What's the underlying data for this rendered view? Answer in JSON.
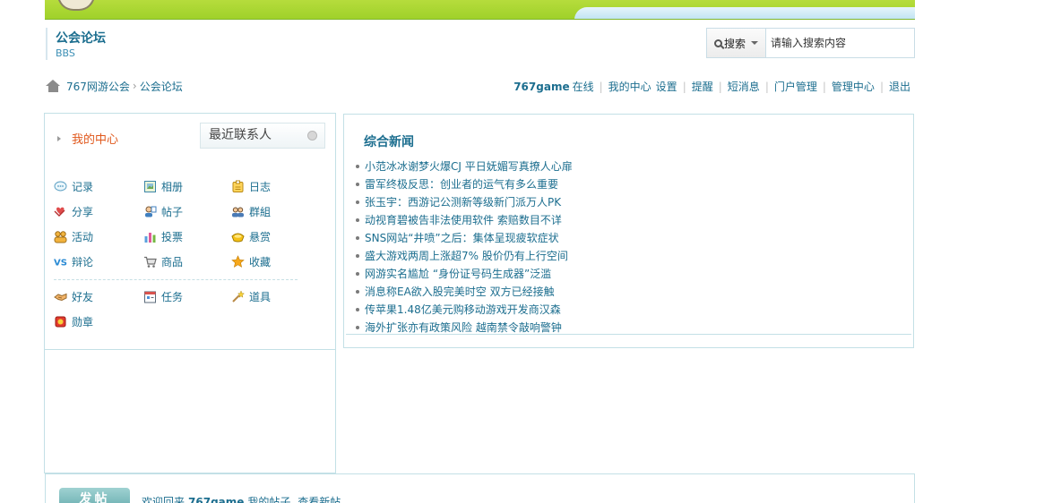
{
  "header": {
    "title": "公会论坛",
    "subtitle": "BBS"
  },
  "search": {
    "button_label": "搜索",
    "placeholder": "请输入搜索内容"
  },
  "breadcrumb": {
    "items": [
      "767网游公会",
      "公会论坛"
    ],
    "separator": "›"
  },
  "topnav": {
    "username": "767game",
    "status": "在线",
    "links": [
      "我的中心",
      "设置",
      "提醒",
      "短消息",
      "门户管理",
      "管理中心",
      "退出"
    ]
  },
  "leftpanel": {
    "tab_mine": "我的中心",
    "tab_recent": "最近联系人",
    "items": [
      {
        "label": "记录",
        "icon": "record-icon"
      },
      {
        "label": "相册",
        "icon": "album-icon"
      },
      {
        "label": "日志",
        "icon": "blog-icon"
      },
      {
        "label": "分享",
        "icon": "share-icon"
      },
      {
        "label": "帖子",
        "icon": "post-icon"
      },
      {
        "label": "群組",
        "icon": "group-icon"
      },
      {
        "label": "活动",
        "icon": "activity-icon"
      },
      {
        "label": "投票",
        "icon": "poll-icon"
      },
      {
        "label": "悬赏",
        "icon": "reward-icon"
      },
      {
        "label": "辩论",
        "icon": "debate-icon"
      },
      {
        "label": "商品",
        "icon": "cart-icon"
      },
      {
        "label": "收藏",
        "icon": "star-icon"
      },
      {
        "label": "好友",
        "icon": "friend-icon"
      },
      {
        "label": "任务",
        "icon": "task-icon"
      },
      {
        "label": "道具",
        "icon": "wand-icon"
      },
      {
        "label": "勋章",
        "icon": "medal-icon"
      }
    ]
  },
  "news": {
    "title": "综合新闻",
    "items": [
      "小范冰冰谢梦火爆CJ 平日妩媚写真撩人心扉",
      "雷军终极反思：创业者的运气有多么重要",
      "张玉宇：西游记公测新等级新门派万人PK",
      "动视育碧被告非法使用软件 索赔数目不详",
      "SNS网站“井喷”之后：集体呈现疲软症状",
      "盛大游戏两周上涨超7% 股价仍有上行空间",
      "网游实名尴尬 “身份证号码生成器”泛滥",
      "消息称EA欲入股完美时空 双方已经接触",
      "传苹果1.48亿美元购移动游戏开发商汉森",
      "海外扩张亦有政策风险 越南禁令敲响警钟"
    ]
  },
  "bottom": {
    "post_label": "发帖",
    "welcome": "欢迎回来",
    "username": "767game",
    "my_posts": "我的帖子",
    "new_posts": "查看新帖"
  }
}
